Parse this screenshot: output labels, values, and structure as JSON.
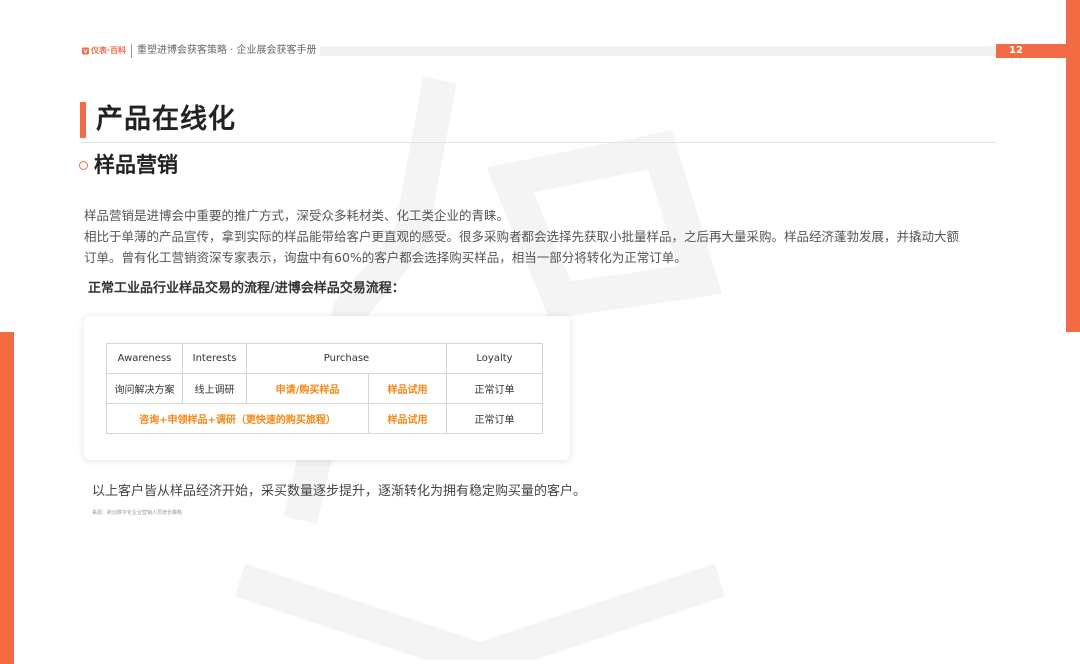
{
  "header": {
    "logo_text": "仪表·百科",
    "title": "重塑进博会获客策略 · 企业展会获客手册",
    "page_number": "12"
  },
  "section": {
    "title": "产品在线化",
    "subtitle": "样品营销"
  },
  "body": {
    "paragraphs": [
      "样品营销是进博会中重要的推广方式，深受众多耗材类、化工类企业的青睐。",
      "相比于单薄的产品宣传，拿到实际的样品能带给客户更直观的感受。很多采购者都会选择先获取小批量样品，之后再大量采购。样品经济蓬勃发展，并撬动大额订单。曾有化工营销资深专家表示，询盘中有60%的客户都会选择购买样品，相当一部分将转化为正常订单。"
    ]
  },
  "flow": {
    "label": "正常工业品行业样品交易的流程/进博会样品交易流程：",
    "headers": [
      "Awareness",
      "Interests",
      "Purchase",
      "Loyalty"
    ],
    "row1": [
      "询问解决方案",
      "线上调研",
      "申请/购买样品",
      "样品试用",
      "正常订单"
    ],
    "row2": [
      "咨询+申领样品+调研（更快速的购买旅程）",
      "样品试用",
      "正常订单"
    ]
  },
  "conclusion": "以上客户皆从样品经济开始，采买数量逐步提升，逐渐转化为拥有稳定购买量的客户。",
  "source": "来源：新创数字化企业营销人员增长策略",
  "colors": {
    "accent": "#f26b43",
    "highlight": "#f2891a"
  }
}
